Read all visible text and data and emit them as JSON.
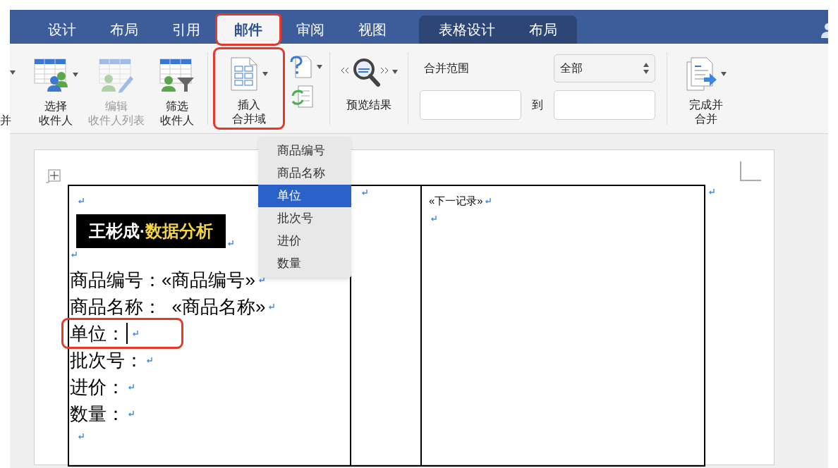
{
  "tabs": [
    {
      "label": "设计",
      "selected": false,
      "contextual": false,
      "highlighted": false
    },
    {
      "label": "布局",
      "selected": false,
      "contextual": false,
      "highlighted": false
    },
    {
      "label": "引用",
      "selected": false,
      "contextual": false,
      "highlighted": false
    },
    {
      "label": "邮件",
      "selected": true,
      "contextual": false,
      "highlighted": true
    },
    {
      "label": "审阅",
      "selected": false,
      "contextual": false,
      "highlighted": false
    },
    {
      "label": "视图",
      "selected": false,
      "contextual": false,
      "highlighted": false
    },
    {
      "label": "表格设计",
      "selected": false,
      "contextual": true,
      "highlighted": false
    },
    {
      "label": "布局",
      "selected": false,
      "contextual": true,
      "highlighted": false
    }
  ],
  "ribbon": {
    "cut_label": "并",
    "recipient_buttons": [
      {
        "kind": "select",
        "lines": [
          "选择",
          "收件人"
        ],
        "disabled": false,
        "dropdown": true
      },
      {
        "kind": "edit",
        "lines": [
          "编辑",
          "收件人列表"
        ],
        "disabled": true,
        "dropdown": false
      },
      {
        "kind": "filter",
        "lines": [
          "筛选",
          "收件人"
        ],
        "disabled": false,
        "dropdown": false
      }
    ],
    "insert_field": {
      "lines": [
        "插入",
        "合并域"
      ],
      "highlighted": true
    },
    "preview": {
      "label": "预览结果"
    },
    "range": {
      "label": "合并范围",
      "select_value": "全部",
      "to_label": "到"
    },
    "finish": {
      "lines": [
        "完成并",
        "合并"
      ]
    }
  },
  "menu": {
    "items": [
      {
        "label": "商品编号",
        "selected": false
      },
      {
        "label": "商品名称",
        "selected": false
      },
      {
        "label": "单位",
        "selected": true
      },
      {
        "label": "批次号",
        "selected": false
      },
      {
        "label": "进价",
        "selected": false
      },
      {
        "label": "数量",
        "selected": false
      }
    ]
  },
  "document": {
    "banner": {
      "name": "王彬成·",
      "accent": "数据分析"
    },
    "lines": [
      {
        "text": "商品编号：«商品编号»",
        "cursor": false,
        "highlighted": false
      },
      {
        "text": "商品名称：  «商品名称»",
        "cursor": false,
        "highlighted": false
      },
      {
        "text": "单位：",
        "cursor": true,
        "highlighted": true
      },
      {
        "text": "批次号：",
        "cursor": false,
        "highlighted": false
      },
      {
        "text": "进价：",
        "cursor": false,
        "highlighted": false
      },
      {
        "text": "数量：",
        "cursor": false,
        "highlighted": false
      }
    ],
    "next_record": "«下一记录»"
  }
}
